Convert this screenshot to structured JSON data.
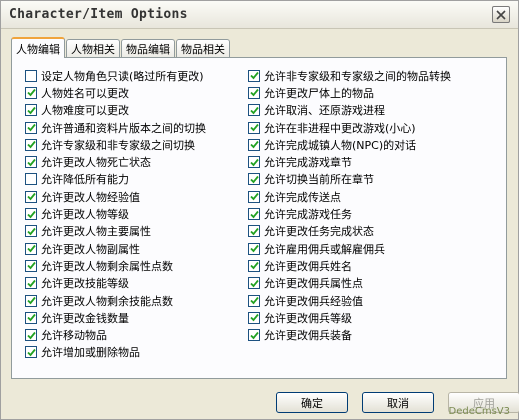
{
  "window": {
    "title": "Character/Item Options"
  },
  "tabs": [
    {
      "label": "人物编辑",
      "active": true
    },
    {
      "label": "人物相关",
      "active": false
    },
    {
      "label": "物品编辑",
      "active": false
    },
    {
      "label": "物品相关",
      "active": false
    }
  ],
  "left_options": [
    {
      "label": "设定人物角色只读(略过所有更改)",
      "checked": false
    },
    {
      "label": "人物姓名可以更改",
      "checked": true
    },
    {
      "label": "人物难度可以更改",
      "checked": true
    },
    {
      "label": "允许普通和资料片版本之间的切换",
      "checked": true
    },
    {
      "label": "允许专家级和非专家级之间切换",
      "checked": true
    },
    {
      "label": "允许更改人物死亡状态",
      "checked": true
    },
    {
      "label": "允许降低所有能力",
      "checked": false
    },
    {
      "label": "允许更改人物经验值",
      "checked": true
    },
    {
      "label": "允许更改人物等级",
      "checked": true
    },
    {
      "label": "允许更改人物主要属性",
      "checked": true
    },
    {
      "label": "允许更改人物副属性",
      "checked": true
    },
    {
      "label": "允许更改人物剩余属性点数",
      "checked": true
    },
    {
      "label": "允许更改技能等级",
      "checked": true
    },
    {
      "label": "允许更改人物剩余技能点数",
      "checked": true
    },
    {
      "label": "允许更改金钱数量",
      "checked": true
    },
    {
      "label": "允许移动物品",
      "checked": true
    },
    {
      "label": "允许增加或删除物品",
      "checked": true
    }
  ],
  "right_options": [
    {
      "label": "允许非专家级和专家级之间的物品转换",
      "checked": true
    },
    {
      "label": "允许更改尸体上的物品",
      "checked": true
    },
    {
      "label": "允许取消、还原游戏进程",
      "checked": true
    },
    {
      "label": "允许在非进程中更改游戏(小心)",
      "checked": true
    },
    {
      "label": "允许完成城镇人物(NPC)的对话",
      "checked": true
    },
    {
      "label": "允许完成游戏章节",
      "checked": true
    },
    {
      "label": "允许切换当前所在章节",
      "checked": true
    },
    {
      "label": "允许完成传送点",
      "checked": true
    },
    {
      "label": "允许完成游戏任务",
      "checked": true
    },
    {
      "label": "允许更改任务完成状态",
      "checked": true
    },
    {
      "label": "允许雇用佣兵或解雇佣兵",
      "checked": true
    },
    {
      "label": "允许更改佣兵姓名",
      "checked": true
    },
    {
      "label": "允许更改佣兵属性点",
      "checked": true
    },
    {
      "label": "允许更改佣兵经验值",
      "checked": true
    },
    {
      "label": "允许更改佣兵等级",
      "checked": true
    },
    {
      "label": "允许更改佣兵装备",
      "checked": true
    }
  ],
  "buttons": {
    "ok": "确定",
    "cancel": "取消",
    "apply": "应用"
  },
  "watermark": "DedeCmsV3"
}
